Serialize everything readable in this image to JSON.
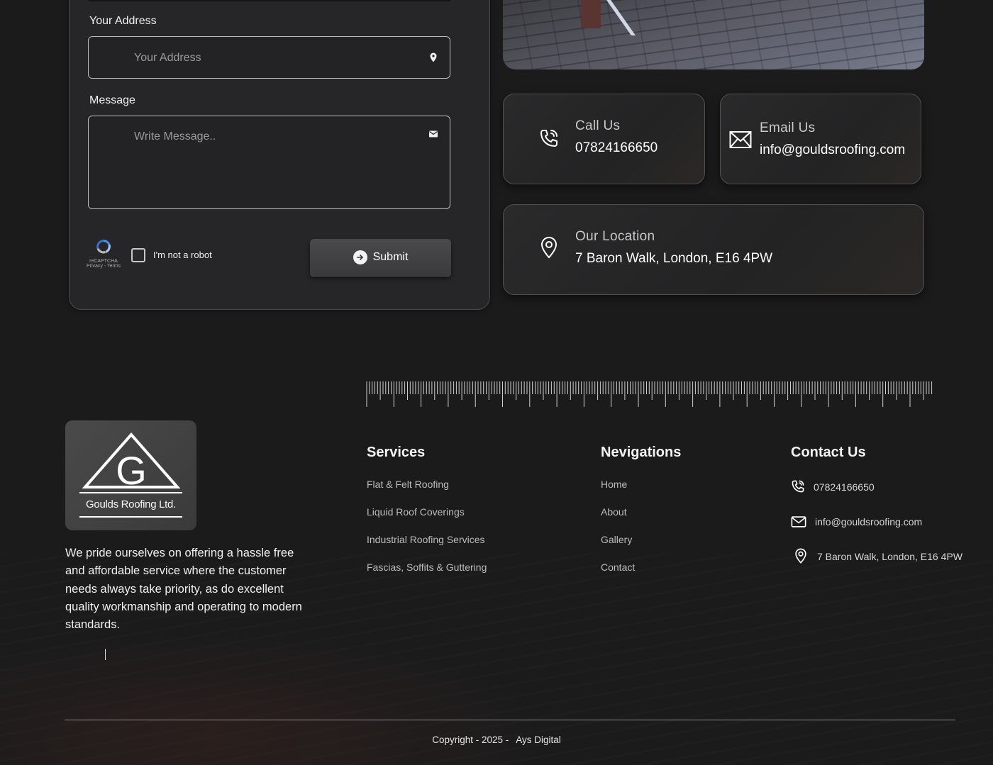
{
  "form": {
    "address_label": "Your Address",
    "address_placeholder": "Your Address",
    "message_label": "Message",
    "message_placeholder": "Write Message..",
    "captcha": {
      "label": "I'm not a robot",
      "brand": "reCAPTCHA",
      "links": "Privacy - Terms"
    },
    "submit_label": "Submit"
  },
  "info_cards": {
    "call": {
      "title": "Call Us",
      "value": "07824166650"
    },
    "email": {
      "title": "Email Us",
      "value": "info@gouldsroofing.com"
    },
    "location": {
      "title": "Our Location",
      "value": "7 Baron Walk, London, E16 4PW"
    }
  },
  "footer": {
    "logo_letter": "G",
    "logo_text": "Goulds Roofing Ltd.",
    "about": "We pride ourselves on offering a hassle free and affordable service where the customer needs always take priority, as do excellent quality workmanship and operating to modern standards.",
    "services": {
      "title": "Services",
      "items": [
        "Flat & Felt Roofing",
        "Liquid Roof Coverings",
        "Industrial Roofing Services",
        "Fascias, Soffits & Guttering"
      ]
    },
    "navigations": {
      "title": "Nevigations",
      "items": [
        "Home",
        "About",
        "Gallery",
        "Contact"
      ]
    },
    "contact": {
      "title": "Contact Us",
      "phone": "07824166650",
      "email": "info@gouldsroofing.com",
      "address": "7 Baron Walk, London, E16 4PW"
    },
    "copyright": "Copyright - 2025 -",
    "credit": "Ays Digital"
  },
  "colors": {
    "background": "#1b1b1c",
    "card": "#262628",
    "text": "#f0f0f0",
    "muted": "#bcbcbc"
  }
}
